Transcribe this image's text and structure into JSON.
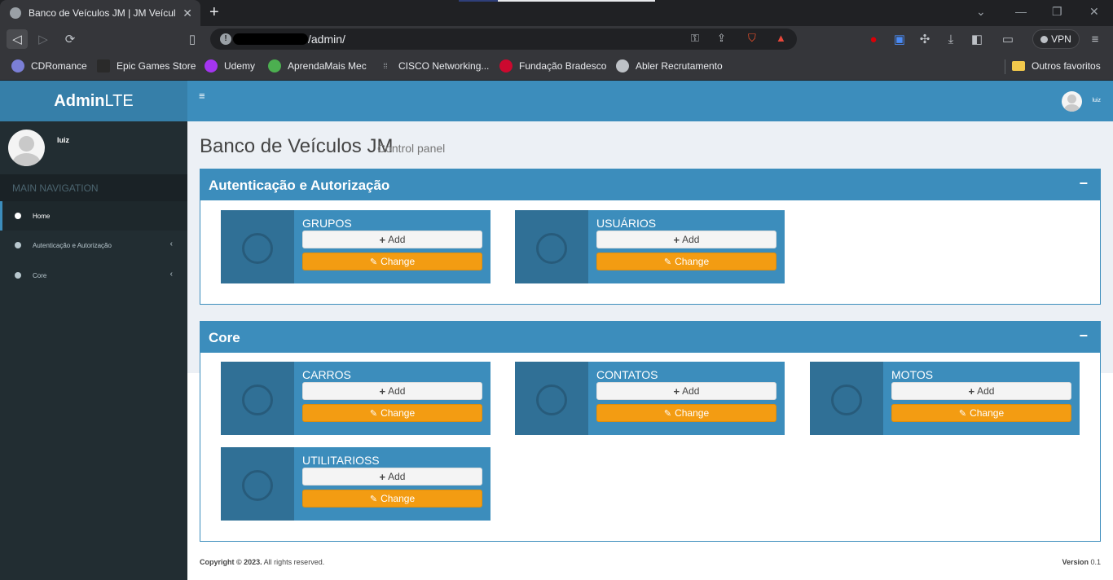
{
  "browser": {
    "tab_title": "Banco de Veículos JM | JM Veícul",
    "url_suffix": "/admin/",
    "new_tab_glyph": "+",
    "close_glyph": "✕",
    "vpn_label": "VPN",
    "bookmarks": [
      "CDRomance",
      "Epic Games Store",
      "Udemy",
      "AprendaMais Mec",
      "CISCO Networking...",
      "Fundação Bradesco",
      "Abler Recrutamento"
    ],
    "other_bookmarks": "Outros favoritos",
    "colors": {
      "tab_bg": "#35363a",
      "frame_bg": "#202124"
    }
  },
  "sidebar": {
    "logo_bold": "Admin",
    "logo_light": "LTE",
    "user_name": "luiz",
    "nav_header": "MAIN NAVIGATION",
    "items": [
      {
        "label": "Home",
        "icon": "dashboard-icon"
      },
      {
        "label": "Autenticação e Autorização",
        "icon": "circle-icon"
      },
      {
        "label": "Core",
        "icon": "circle-icon"
      }
    ]
  },
  "header": {
    "toggle_glyph": "≡",
    "user_name": "luiz"
  },
  "content": {
    "title": "Banco de Veículos JM",
    "subtitle": "Control panel",
    "add_label": "Add",
    "change_label": "Change",
    "boxes": [
      {
        "title": "Autenticação e Autorização",
        "collapse_glyph": "−",
        "models": [
          "GRUPOS",
          "USUÁRIOS"
        ]
      },
      {
        "title": "Core",
        "collapse_glyph": "−",
        "models": [
          "CARROS",
          "CONTATOS",
          "MOTOS",
          "UTILITARIOSS"
        ]
      }
    ]
  },
  "footer": {
    "copyright_bold": "Copyright © 2023.",
    "copyright_rest": "All rights reserved.",
    "version_label": "Version",
    "version_value": "0.1"
  },
  "colors": {
    "primary": "#3c8dbc",
    "logo_bg": "#367fa9",
    "sidebar_bg": "#222d32",
    "warning": "#f39c12",
    "content_bg": "#ecf0f5"
  }
}
